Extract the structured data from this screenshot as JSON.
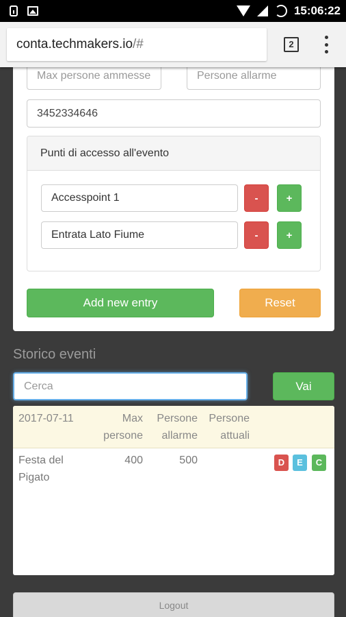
{
  "status_bar": {
    "time": "15:06:22"
  },
  "browser": {
    "url_host": "conta.techmakers.io",
    "url_path": "/#",
    "tab_count": "2"
  },
  "form": {
    "max_people_placeholder": "Max persone ammesse",
    "alarm_people_placeholder": "Persone allarme",
    "phone_value": "3452334646",
    "access_points_heading": "Punti di accesso all'evento",
    "access_points": [
      {
        "name": "Accesspoint 1",
        "remove_label": "-",
        "add_label": "+"
      },
      {
        "name": "Entrata Lato Fiume",
        "remove_label": "-",
        "add_label": "+"
      }
    ],
    "add_entry_label": "Add new entry",
    "reset_label": "Reset"
  },
  "history": {
    "title": "Storico eventi",
    "search_placeholder": "Cerca",
    "search_button": "Vai",
    "columns": {
      "date": "2017-07-11",
      "max_people_1": "Max",
      "max_people_2": "persone",
      "alarm_1": "Persone",
      "alarm_2": "allarme",
      "current_1": "Persone",
      "current_2": "attuali"
    },
    "rows": [
      {
        "name_1": "Festa del",
        "name_2": "Pigato",
        "max_people": "400",
        "alarm": "500",
        "current": "",
        "action_delete": "D",
        "action_edit": "E",
        "action_count": "C"
      }
    ]
  },
  "logout_label": "Logout",
  "colors": {
    "success": "#5cb85c",
    "danger": "#d9534f",
    "warning": "#f0ad4e",
    "info": "#5bc0de",
    "table_header_bg": "#fcf8e3",
    "page_bg": "#3b3b3b"
  },
  "icons": [
    "sim-icon",
    "image-icon",
    "wifi-icon",
    "signal-icon",
    "battery-icon",
    "tabs-icon",
    "menu-icon"
  ]
}
